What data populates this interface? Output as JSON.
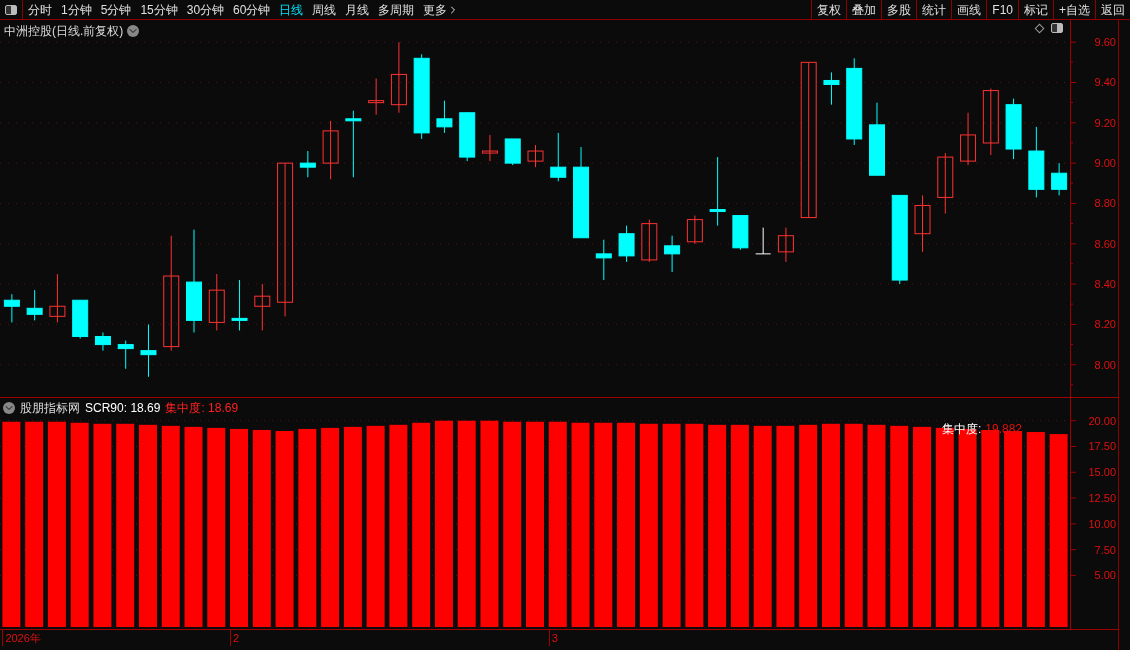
{
  "toolbar": {
    "periods": [
      {
        "label": "分时",
        "selected": false
      },
      {
        "label": "1分钟",
        "selected": false
      },
      {
        "label": "5分钟",
        "selected": false
      },
      {
        "label": "15分钟",
        "selected": false
      },
      {
        "label": "30分钟",
        "selected": false
      },
      {
        "label": "60分钟",
        "selected": false
      },
      {
        "label": "日线",
        "selected": true
      },
      {
        "label": "周线",
        "selected": false
      },
      {
        "label": "月线",
        "selected": false
      },
      {
        "label": "多周期",
        "selected": false
      },
      {
        "label": "更多",
        "selected": false
      }
    ],
    "actions": [
      "复权",
      "叠加",
      "多股",
      "统计",
      "画线",
      "F10",
      "标记",
      "+自选",
      "返回"
    ]
  },
  "main_chart": {
    "title": "中洲控股(日线.前复权)",
    "chart_data": {
      "type": "candlestick",
      "grid": true,
      "ylim": [
        7.84,
        9.71
      ],
      "categories": [
        null,
        null,
        null,
        null,
        null,
        null,
        null,
        null,
        null,
        null,
        null,
        null,
        null,
        null,
        null,
        null,
        null,
        null,
        null,
        null,
        null,
        null,
        null,
        null,
        null,
        null,
        null,
        null,
        null,
        null,
        null,
        null,
        null,
        null,
        null,
        null,
        null,
        null,
        null,
        null,
        null,
        null,
        null,
        null,
        null,
        null,
        null
      ],
      "yticks": [
        {
          "value": 9.6,
          "label": "9.60"
        },
        {
          "value": 9.4,
          "label": "9.40"
        },
        {
          "value": 9.2,
          "label": "9.20"
        },
        {
          "value": 9.0,
          "label": "9.00"
        },
        {
          "value": 8.8,
          "label": "8.80"
        },
        {
          "value": 8.6,
          "label": "8.60"
        },
        {
          "value": 8.4,
          "label": "8.40"
        },
        {
          "value": 8.2,
          "label": "8.20"
        },
        {
          "value": 8.0,
          "label": "8.00"
        }
      ],
      "ohlc": [
        [
          8.32,
          8.35,
          8.21,
          8.29
        ],
        [
          8.28,
          8.37,
          8.22,
          8.25
        ],
        [
          8.24,
          8.45,
          8.21,
          8.29
        ],
        [
          8.32,
          8.32,
          8.13,
          8.14
        ],
        [
          8.14,
          8.16,
          8.07,
          8.1
        ],
        [
          8.1,
          8.12,
          7.98,
          8.08
        ],
        [
          8.07,
          8.2,
          7.94,
          8.05
        ],
        [
          8.09,
          8.64,
          8.07,
          8.44
        ],
        [
          8.41,
          8.67,
          8.16,
          8.22
        ],
        [
          8.21,
          8.45,
          8.17,
          8.37
        ],
        [
          8.23,
          8.42,
          8.17,
          8.22
        ],
        [
          8.29,
          8.4,
          8.17,
          8.34
        ],
        [
          8.31,
          9.0,
          8.24,
          9.0
        ],
        [
          9.0,
          9.06,
          8.93,
          8.98
        ],
        [
          9.0,
          9.21,
          8.92,
          9.16
        ],
        [
          9.22,
          9.26,
          8.93,
          9.21
        ],
        [
          9.3,
          9.42,
          9.24,
          9.31
        ],
        [
          9.29,
          9.6,
          9.25,
          9.44
        ],
        [
          9.52,
          9.54,
          9.12,
          9.15
        ],
        [
          9.22,
          9.31,
          9.15,
          9.18
        ],
        [
          9.25,
          9.25,
          9.01,
          9.03
        ],
        [
          9.05,
          9.14,
          9.01,
          9.06
        ],
        [
          9.12,
          9.12,
          8.99,
          9.0
        ],
        [
          9.01,
          9.09,
          8.98,
          9.06
        ],
        [
          8.98,
          9.15,
          8.91,
          8.93
        ],
        [
          8.98,
          9.08,
          8.63,
          8.63
        ],
        [
          8.55,
          8.62,
          8.42,
          8.53
        ],
        [
          8.65,
          8.69,
          8.51,
          8.54
        ],
        [
          8.52,
          8.72,
          8.51,
          8.7
        ],
        [
          8.59,
          8.64,
          8.46,
          8.55
        ],
        [
          8.61,
          8.74,
          8.6,
          8.72
        ],
        [
          8.77,
          9.03,
          8.69,
          8.76
        ],
        [
          8.74,
          8.74,
          8.57,
          8.58
        ],
        [
          8.55,
          8.68,
          8.55,
          8.55
        ],
        [
          8.56,
          8.68,
          8.51,
          8.64
        ],
        [
          8.73,
          9.5,
          8.73,
          9.5
        ],
        [
          9.41,
          9.45,
          9.29,
          9.39
        ],
        [
          9.47,
          9.52,
          9.09,
          9.12
        ],
        [
          9.19,
          9.3,
          8.94,
          8.94
        ],
        [
          8.84,
          8.84,
          8.4,
          8.42
        ],
        [
          8.65,
          8.84,
          8.56,
          8.79
        ],
        [
          8.83,
          9.05,
          8.75,
          9.03
        ],
        [
          9.01,
          9.25,
          8.99,
          9.14
        ],
        [
          9.1,
          9.37,
          9.04,
          9.36
        ],
        [
          9.29,
          9.32,
          9.02,
          9.07
        ],
        [
          9.06,
          9.18,
          8.83,
          8.87
        ],
        [
          8.95,
          9.0,
          8.84,
          8.87
        ]
      ]
    }
  },
  "indicator": {
    "name": "股朋指标网",
    "readings": [
      {
        "label": "SCR90:",
        "value": "18.69",
        "color": "#ffffff"
      },
      {
        "label": "集中度:",
        "value": "18.69",
        "color": "#ff2020"
      }
    ],
    "latest": {
      "label": "集中度:",
      "value": "19.882"
    },
    "chart_data": {
      "type": "bar",
      "grid": true,
      "ylim": [
        0,
        22.2
      ],
      "categories": [
        null,
        null,
        null,
        null,
        null,
        null,
        null,
        null,
        null,
        null,
        null,
        null,
        null,
        null,
        null,
        null,
        null,
        null,
        null,
        null,
        null,
        null,
        null,
        null,
        null,
        null,
        null,
        null,
        null,
        null,
        null,
        null,
        null,
        null,
        null,
        null,
        null,
        null,
        null,
        null,
        null,
        null,
        null,
        null,
        null,
        null,
        null
      ],
      "yticks": [
        {
          "value": 20,
          "label": "20.00"
        },
        {
          "value": 17.5,
          "label": "17.50"
        },
        {
          "value": 15,
          "label": "15.00"
        },
        {
          "value": 12.5,
          "label": "12.50"
        },
        {
          "value": 10,
          "label": "10.00"
        },
        {
          "value": 7.5,
          "label": "7.50"
        },
        {
          "value": 5,
          "label": "5.00"
        }
      ],
      "series": [
        {
          "color": "#ff0000",
          "values": [
            19.9,
            19.9,
            19.9,
            19.8,
            19.7,
            19.7,
            19.6,
            19.5,
            19.4,
            19.3,
            19.2,
            19.1,
            19.0,
            19.2,
            19.3,
            19.4,
            19.5,
            19.6,
            19.8,
            20.0,
            20.0,
            20.0,
            19.9,
            19.9,
            19.9,
            19.8,
            19.8,
            19.8,
            19.7,
            19.7,
            19.7,
            19.6,
            19.6,
            19.5,
            19.5,
            19.6,
            19.7,
            19.7,
            19.6,
            19.5,
            19.4,
            19.3,
            19.2,
            19.1,
            19.0,
            18.9,
            18.7
          ]
        }
      ]
    },
    "date_axis": [
      "2026年",
      "2",
      "3"
    ]
  }
}
